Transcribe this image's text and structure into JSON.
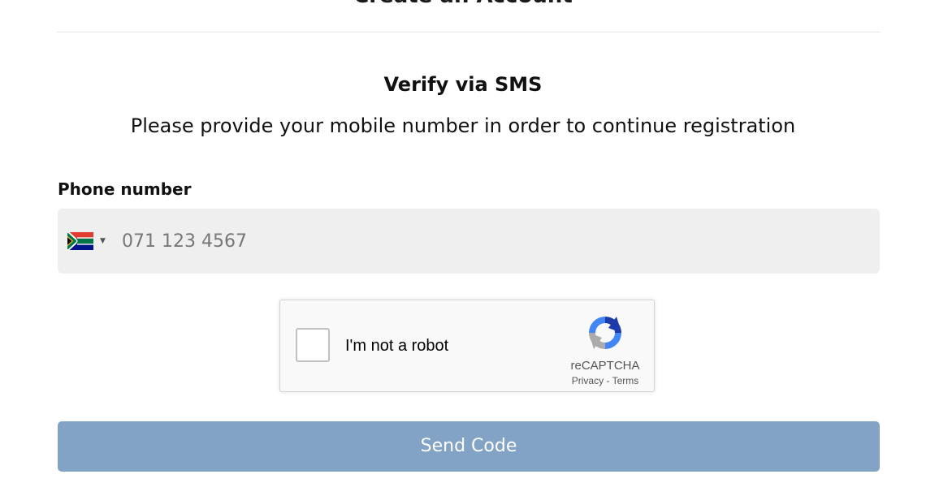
{
  "page": {
    "title": "Create an Account"
  },
  "verify": {
    "heading": "Verify via SMS",
    "description": "Please provide your mobile number in order to continue registration"
  },
  "phone": {
    "label": "Phone number",
    "placeholder": "071 123 4567",
    "value": "",
    "country_flag_icon": "south-africa-flag-icon",
    "dropdown_icon": "caret-down-icon"
  },
  "recaptcha": {
    "checkbox_label": "I'm not a robot",
    "brand": "reCAPTCHA",
    "privacy_link": "Privacy",
    "separator": "-",
    "terms_link": "Terms",
    "logo_icon": "recaptcha-logo-icon"
  },
  "actions": {
    "send_code_label": "Send Code"
  },
  "colors": {
    "button_bg": "#82a3c6",
    "input_bg": "#efefef",
    "divider": "#e6e6e6"
  }
}
